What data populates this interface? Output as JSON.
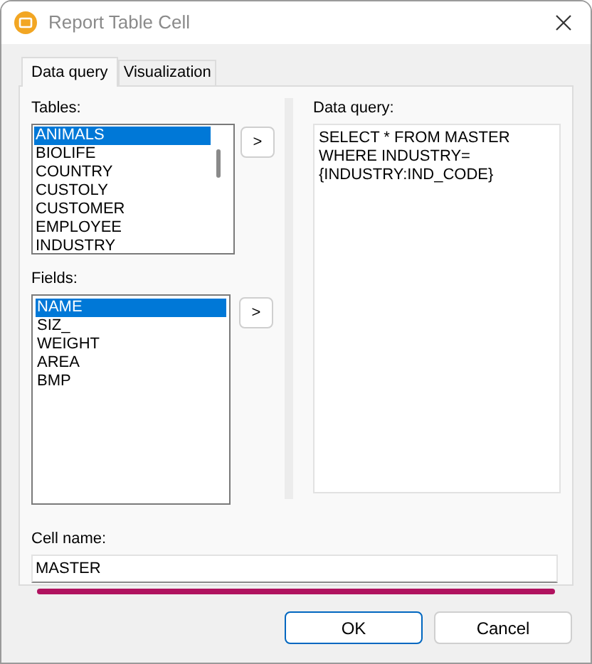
{
  "window": {
    "title": "Report Table Cell"
  },
  "tabs": [
    {
      "label": "Data query",
      "selected": true
    },
    {
      "label": "Visualization",
      "selected": false
    }
  ],
  "tables": {
    "label": "Tables:",
    "items": [
      {
        "label": "ANIMALS",
        "selected": true
      },
      {
        "label": "BIOLIFE",
        "selected": false
      },
      {
        "label": "COUNTRY",
        "selected": false
      },
      {
        "label": "CUSTOLY",
        "selected": false
      },
      {
        "label": "CUSTOMER",
        "selected": false
      },
      {
        "label": "EMPLOYEE",
        "selected": false
      },
      {
        "label": "INDUSTRY",
        "selected": false
      }
    ],
    "add_button": ">"
  },
  "fields": {
    "label": "Fields:",
    "items": [
      {
        "label": "NAME",
        "selected": true
      },
      {
        "label": "SIZ_",
        "selected": false
      },
      {
        "label": "WEIGHT",
        "selected": false
      },
      {
        "label": "AREA",
        "selected": false
      },
      {
        "label": "BMP",
        "selected": false
      }
    ],
    "add_button": ">"
  },
  "data_query": {
    "label": "Data query:",
    "value": "SELECT * FROM MASTER WHERE INDUSTRY=\n{INDUSTRY:IND_CODE}"
  },
  "cell_name": {
    "label": "Cell name:",
    "value": "MASTER"
  },
  "buttons": [
    {
      "label": "OK",
      "default": true
    },
    {
      "label": "Cancel",
      "default": false
    }
  ]
}
